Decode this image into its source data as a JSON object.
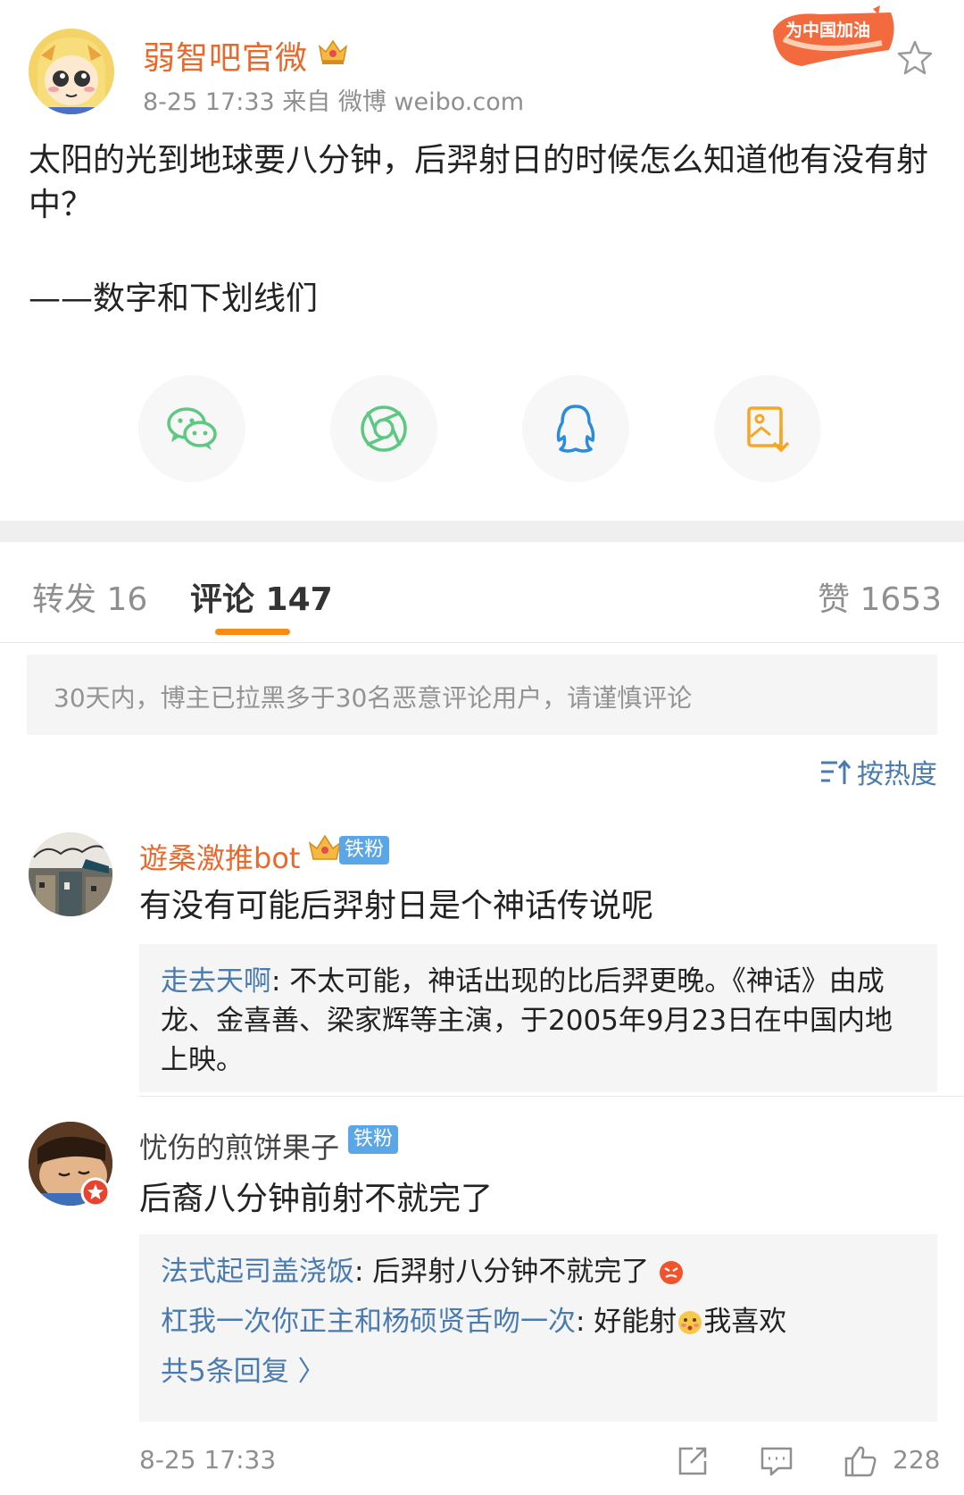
{
  "post": {
    "author": "弱智吧官微",
    "meta": "8-25 17:33   来自 微博 weibo.com",
    "promo_badge": "为中国加油",
    "body": "太阳的光到地球要八分钟，后羿射日的时候怎么知道他有没有射中？",
    "signature": "——数字和下划线们"
  },
  "share": {
    "icons": [
      "wechat-icon",
      "moments-icon",
      "qq-icon",
      "save-image-icon"
    ],
    "colors": {
      "wechat": "#5cc882",
      "moments": "#5cc882",
      "qq": "#2c8bdb",
      "save": "#f5a623"
    }
  },
  "tabs": {
    "repost": "转发 16",
    "comments": "评论 147",
    "likes": "赞 1653"
  },
  "notice": "30天内，博主已拉黑多于30名恶意评论用户，请谨慎评论",
  "sort_label": "按热度",
  "comments": [
    {
      "name": "遊桑激推bot",
      "badge": "铁粉",
      "text": "有没有可能后羿射日是个神话传说呢",
      "replies": [
        {
          "user": "走去天啊",
          "text": ": 不太可能，神话出现的比后羿更晚。《神话》由成龙、金喜善、梁家辉等主演，于2005年9月23日在中国内地上映。"
        }
      ]
    },
    {
      "name": "忧伤的煎饼果子",
      "badge": "铁粉",
      "text": "后裔八分钟前射不就完了",
      "replies": [
        {
          "user": "法式起司盖浇饭",
          "text": ": 后羿射八分钟不就完了"
        },
        {
          "user": "杠我一次你正主和杨硕贤舌吻一次",
          "text": ": 好能射",
          "text_after": "我喜欢"
        }
      ],
      "more": "共5条回复 〉",
      "time": "8-25 17:33",
      "likes": "228"
    }
  ],
  "colors": {
    "accent_orange": "#f78b14",
    "author_orange": "#e8692b",
    "link_blue": "#4a7bb0",
    "fan_badge_blue": "#5ba6e6"
  }
}
